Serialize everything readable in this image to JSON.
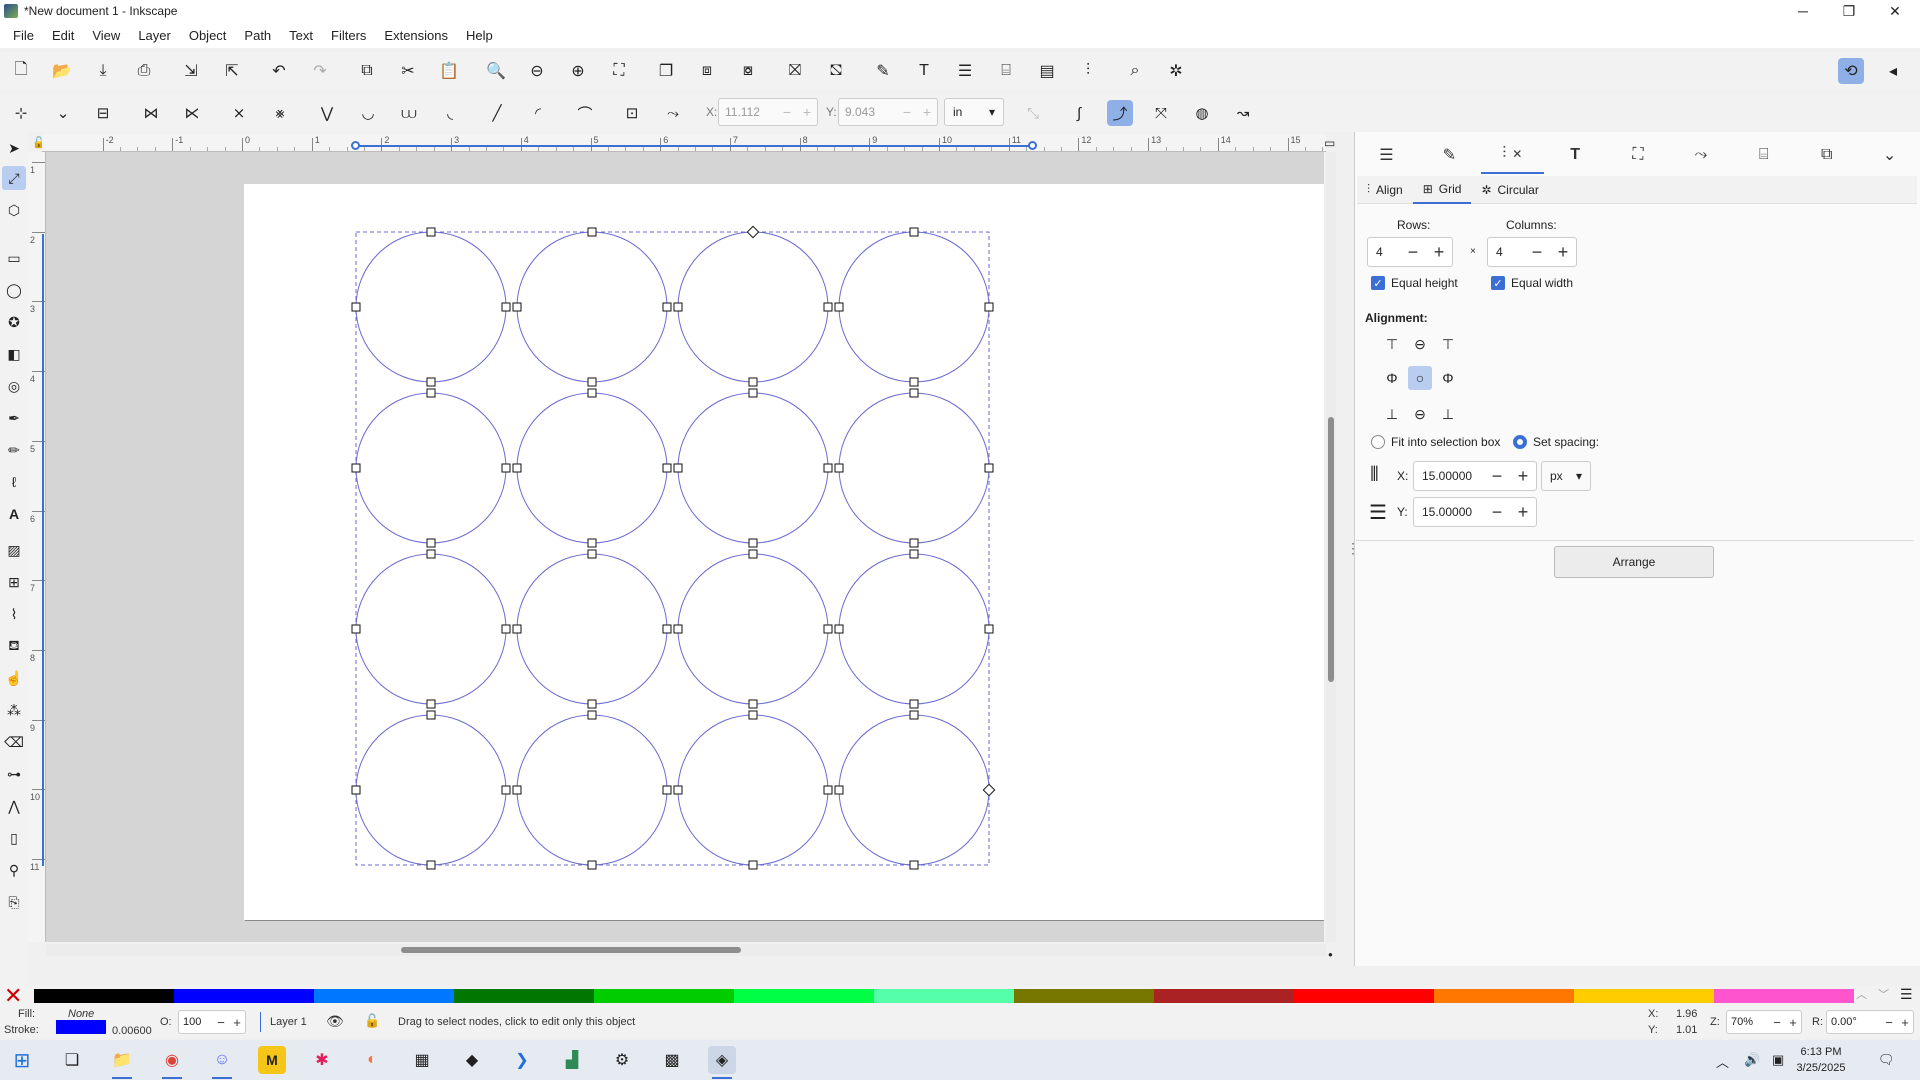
{
  "window": {
    "title": "*New document 1 - Inkscape",
    "minimize_glyph": "─",
    "maximize_glyph": "❐",
    "close_glyph": "✕"
  },
  "menu": [
    "File",
    "Edit",
    "View",
    "Layer",
    "Object",
    "Path",
    "Text",
    "Filters",
    "Extensions",
    "Help"
  ],
  "tool_controls": {
    "x_label": "X:",
    "x_value": "11.112",
    "y_label": "Y:",
    "y_value": "9.043",
    "unit": "in"
  },
  "rulers": {
    "h_numbers": [
      "-2",
      "-1",
      "0",
      "1",
      "2",
      "3",
      "4",
      "5",
      "6",
      "7",
      "8",
      "9",
      "10",
      "11",
      "12",
      "13",
      "14",
      "15"
    ],
    "v_numbers": [
      "1",
      "2",
      "3",
      "4",
      "5",
      "6",
      "7",
      "8",
      "9",
      "10",
      "11"
    ]
  },
  "dock": {
    "subtabs": [
      "Align",
      "Grid",
      "Circular"
    ],
    "rows_label": "Rows:",
    "rows_value": "4",
    "columns_label": "Columns:",
    "columns_value": "4",
    "times_glyph": "×",
    "equal_height": "Equal height",
    "equal_width": "Equal width",
    "alignment_label": "Alignment:",
    "fit_label": "Fit into selection box",
    "spacing_label": "Set spacing:",
    "spacing_x_label": "X:",
    "spacing_x_value": "15.00000",
    "spacing_y_label": "Y:",
    "spacing_y_value": "15.00000",
    "spacing_unit": "px",
    "arrange_label": "Arrange"
  },
  "palette_colors": [
    "#000000",
    "#0000ff",
    "#0077ff",
    "#007700",
    "#00cc00",
    "#00ff44",
    "#55ffaa",
    "#777700",
    "#aa2222",
    "#ff0000",
    "#ff7700",
    "#ffcc00",
    "#ff55cc"
  ],
  "status": {
    "fill_label": "Fill:",
    "fill_value": "None",
    "stroke_label": "Stroke:",
    "stroke_width": "0.00600",
    "opacity_label": "O:",
    "opacity_value": "100",
    "layer_name": "Layer 1",
    "message": "Drag to select nodes, click to edit only this object",
    "cursor_x_label": "X:",
    "cursor_x": "1.96",
    "cursor_y_label": "Y:",
    "cursor_y": "1.01",
    "zoom_label": "Z:",
    "zoom_value": "70%",
    "rotation_label": "R:",
    "rotation_value": "0.00°"
  },
  "taskbar": {
    "time": "6:13 PM",
    "date": "3/25/2025"
  }
}
